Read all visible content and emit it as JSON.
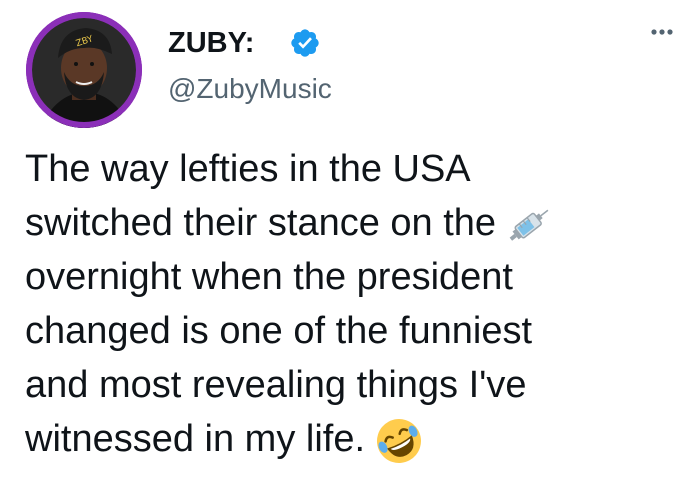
{
  "author": {
    "display_name": "ZUBY:",
    "handle": "@ZubyMusic",
    "verified": true,
    "verified_color": "#1d9bf0",
    "avatar_ring_color": "#8b2fb8"
  },
  "icons": {
    "verified": "verified-badge-icon",
    "more": "more-options-icon",
    "syringe": "syringe-emoji",
    "laughing": "rolling-on-floor-laughing-emoji"
  },
  "tweet": {
    "lines": [
      "The way lefties in the USA",
      "switched their stance on the",
      "overnight when the president",
      "changed is one of the funniest",
      "and most revealing things I've",
      "witnessed in my life."
    ]
  }
}
